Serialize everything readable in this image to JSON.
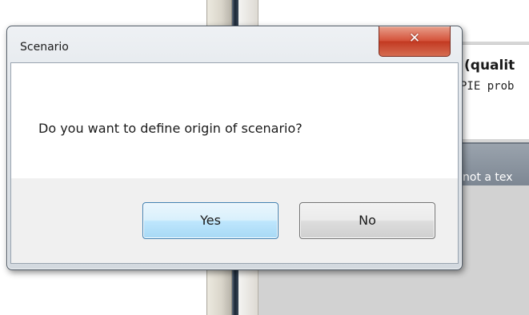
{
  "dialog": {
    "title": "Scenario",
    "close_icon": "close-icon",
    "message": "Do you want to define origin of scenario?",
    "buttons": {
      "yes_label": "Yes",
      "no_label": "No"
    }
  },
  "background": {
    "heading_fragment": "(qualit",
    "subtext_fragment": "PIE prob",
    "field_fragment": "not a tex"
  },
  "colors": {
    "close_button": "#c94a30",
    "default_button_border": "#3c7fb1",
    "title_bar": "#dde2e8"
  }
}
